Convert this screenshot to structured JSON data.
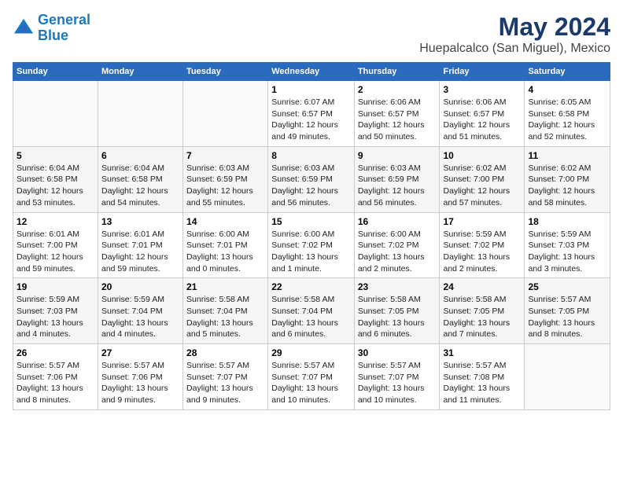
{
  "header": {
    "logo_line1": "General",
    "logo_line2": "Blue",
    "title": "May 2024",
    "subtitle": "Huepalcalco (San Miguel), Mexico"
  },
  "days_of_week": [
    "Sunday",
    "Monday",
    "Tuesday",
    "Wednesday",
    "Thursday",
    "Friday",
    "Saturday"
  ],
  "weeks": [
    [
      {
        "day": "",
        "info": ""
      },
      {
        "day": "",
        "info": ""
      },
      {
        "day": "",
        "info": ""
      },
      {
        "day": "1",
        "info": "Sunrise: 6:07 AM\nSunset: 6:57 PM\nDaylight: 12 hours\nand 49 minutes."
      },
      {
        "day": "2",
        "info": "Sunrise: 6:06 AM\nSunset: 6:57 PM\nDaylight: 12 hours\nand 50 minutes."
      },
      {
        "day": "3",
        "info": "Sunrise: 6:06 AM\nSunset: 6:57 PM\nDaylight: 12 hours\nand 51 minutes."
      },
      {
        "day": "4",
        "info": "Sunrise: 6:05 AM\nSunset: 6:58 PM\nDaylight: 12 hours\nand 52 minutes."
      }
    ],
    [
      {
        "day": "5",
        "info": "Sunrise: 6:04 AM\nSunset: 6:58 PM\nDaylight: 12 hours\nand 53 minutes."
      },
      {
        "day": "6",
        "info": "Sunrise: 6:04 AM\nSunset: 6:58 PM\nDaylight: 12 hours\nand 54 minutes."
      },
      {
        "day": "7",
        "info": "Sunrise: 6:03 AM\nSunset: 6:59 PM\nDaylight: 12 hours\nand 55 minutes."
      },
      {
        "day": "8",
        "info": "Sunrise: 6:03 AM\nSunset: 6:59 PM\nDaylight: 12 hours\nand 56 minutes."
      },
      {
        "day": "9",
        "info": "Sunrise: 6:03 AM\nSunset: 6:59 PM\nDaylight: 12 hours\nand 56 minutes."
      },
      {
        "day": "10",
        "info": "Sunrise: 6:02 AM\nSunset: 7:00 PM\nDaylight: 12 hours\nand 57 minutes."
      },
      {
        "day": "11",
        "info": "Sunrise: 6:02 AM\nSunset: 7:00 PM\nDaylight: 12 hours\nand 58 minutes."
      }
    ],
    [
      {
        "day": "12",
        "info": "Sunrise: 6:01 AM\nSunset: 7:00 PM\nDaylight: 12 hours\nand 59 minutes."
      },
      {
        "day": "13",
        "info": "Sunrise: 6:01 AM\nSunset: 7:01 PM\nDaylight: 12 hours\nand 59 minutes."
      },
      {
        "day": "14",
        "info": "Sunrise: 6:00 AM\nSunset: 7:01 PM\nDaylight: 13 hours\nand 0 minutes."
      },
      {
        "day": "15",
        "info": "Sunrise: 6:00 AM\nSunset: 7:02 PM\nDaylight: 13 hours\nand 1 minute."
      },
      {
        "day": "16",
        "info": "Sunrise: 6:00 AM\nSunset: 7:02 PM\nDaylight: 13 hours\nand 2 minutes."
      },
      {
        "day": "17",
        "info": "Sunrise: 5:59 AM\nSunset: 7:02 PM\nDaylight: 13 hours\nand 2 minutes."
      },
      {
        "day": "18",
        "info": "Sunrise: 5:59 AM\nSunset: 7:03 PM\nDaylight: 13 hours\nand 3 minutes."
      }
    ],
    [
      {
        "day": "19",
        "info": "Sunrise: 5:59 AM\nSunset: 7:03 PM\nDaylight: 13 hours\nand 4 minutes."
      },
      {
        "day": "20",
        "info": "Sunrise: 5:59 AM\nSunset: 7:04 PM\nDaylight: 13 hours\nand 4 minutes."
      },
      {
        "day": "21",
        "info": "Sunrise: 5:58 AM\nSunset: 7:04 PM\nDaylight: 13 hours\nand 5 minutes."
      },
      {
        "day": "22",
        "info": "Sunrise: 5:58 AM\nSunset: 7:04 PM\nDaylight: 13 hours\nand 6 minutes."
      },
      {
        "day": "23",
        "info": "Sunrise: 5:58 AM\nSunset: 7:05 PM\nDaylight: 13 hours\nand 6 minutes."
      },
      {
        "day": "24",
        "info": "Sunrise: 5:58 AM\nSunset: 7:05 PM\nDaylight: 13 hours\nand 7 minutes."
      },
      {
        "day": "25",
        "info": "Sunrise: 5:57 AM\nSunset: 7:05 PM\nDaylight: 13 hours\nand 8 minutes."
      }
    ],
    [
      {
        "day": "26",
        "info": "Sunrise: 5:57 AM\nSunset: 7:06 PM\nDaylight: 13 hours\nand 8 minutes."
      },
      {
        "day": "27",
        "info": "Sunrise: 5:57 AM\nSunset: 7:06 PM\nDaylight: 13 hours\nand 9 minutes."
      },
      {
        "day": "28",
        "info": "Sunrise: 5:57 AM\nSunset: 7:07 PM\nDaylight: 13 hours\nand 9 minutes."
      },
      {
        "day": "29",
        "info": "Sunrise: 5:57 AM\nSunset: 7:07 PM\nDaylight: 13 hours\nand 10 minutes."
      },
      {
        "day": "30",
        "info": "Sunrise: 5:57 AM\nSunset: 7:07 PM\nDaylight: 13 hours\nand 10 minutes."
      },
      {
        "day": "31",
        "info": "Sunrise: 5:57 AM\nSunset: 7:08 PM\nDaylight: 13 hours\nand 11 minutes."
      },
      {
        "day": "",
        "info": ""
      }
    ]
  ]
}
